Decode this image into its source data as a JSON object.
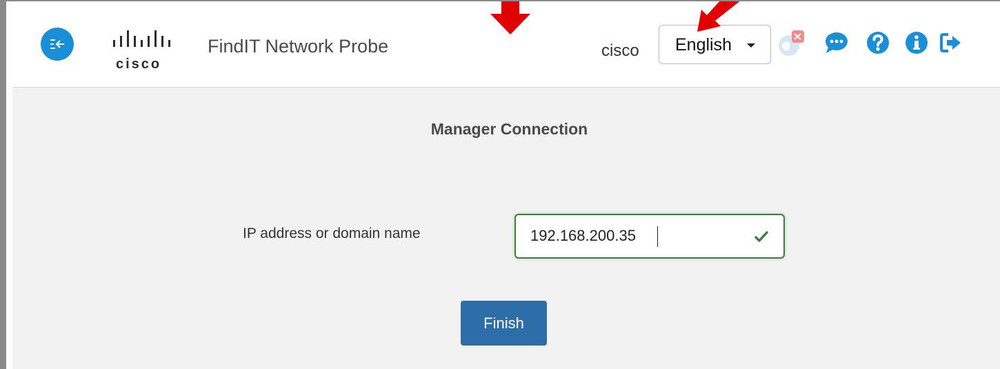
{
  "header": {
    "logo_text": "cisco",
    "app_title": "FindIT Network Probe",
    "username": "cisco",
    "language": {
      "selected": "English"
    },
    "icons": [
      "collapse-menu-icon",
      "notifications-globe-icon",
      "chat-icon",
      "help-icon",
      "info-icon",
      "logout-icon"
    ]
  },
  "main": {
    "section_title": "Manager Connection",
    "ip_field": {
      "label": "IP address or domain name",
      "value": "192.168.200.35",
      "valid": true
    },
    "finish_label": "Finish"
  },
  "colors": {
    "brand_blue": "#1a8fd8",
    "button_blue": "#2d6da8",
    "valid_green": "#3c7f3c",
    "annotation_red": "#e00000"
  }
}
